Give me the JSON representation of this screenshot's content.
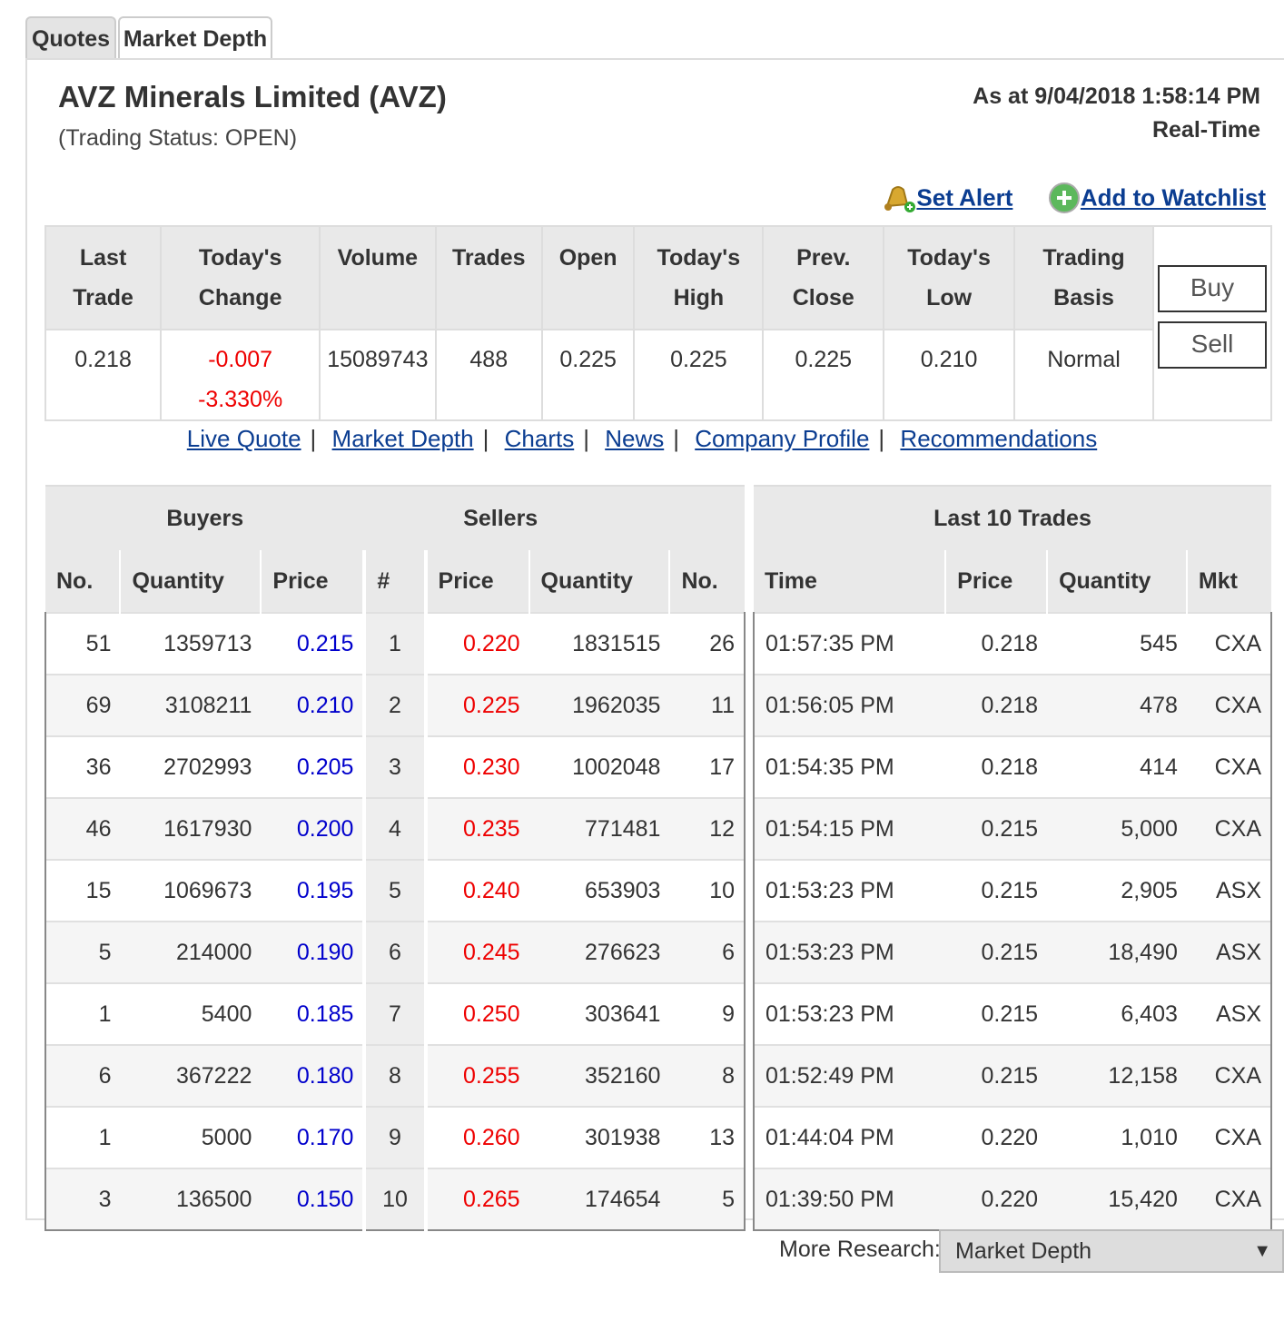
{
  "tabs": [
    {
      "label": "Quotes"
    },
    {
      "label": "Market Depth"
    }
  ],
  "company": {
    "name": "AVZ Minerals Limited (AVZ)",
    "status": "(Trading Status: OPEN)"
  },
  "as_at": {
    "datetime": "As at 9/04/2018 1:58:14 PM",
    "feed": "Real-Time"
  },
  "actions": {
    "set_alert": "Set Alert",
    "add_watchlist": "Add to Watchlist"
  },
  "quote_headers": [
    [
      "Last",
      "Trade"
    ],
    [
      "Today's",
      "Change"
    ],
    [
      "Volume",
      ""
    ],
    [
      "Trades",
      ""
    ],
    [
      "Open",
      ""
    ],
    [
      "Today's",
      "High"
    ],
    [
      "Prev.",
      "Close"
    ],
    [
      "Today's",
      "Low"
    ],
    [
      "Trading",
      "Basis"
    ]
  ],
  "quote_values": {
    "last_trade": "0.218",
    "change": "-0.007",
    "change_pct": "-3.330%",
    "volume": "15089743",
    "trades": "488",
    "open": "0.225",
    "high": "0.225",
    "prev_close": "0.225",
    "low": "0.210",
    "basis": "Normal"
  },
  "buttons": {
    "buy": "Buy",
    "sell": "Sell"
  },
  "nav_links": [
    "Live Quote",
    "Market Depth",
    "Charts",
    "News",
    "Company Profile",
    "Recommendations"
  ],
  "depth": {
    "buyers_title": "Buyers",
    "sellers_title": "Sellers",
    "buyer_cols": [
      "No.",
      "Quantity",
      "Price"
    ],
    "num_col": "#",
    "seller_cols": [
      "Price",
      "Quantity",
      "No."
    ],
    "buyers": [
      [
        "51",
        "1359713",
        "0.215"
      ],
      [
        "69",
        "3108211",
        "0.210"
      ],
      [
        "36",
        "2702993",
        "0.205"
      ],
      [
        "46",
        "1617930",
        "0.200"
      ],
      [
        "15",
        "1069673",
        "0.195"
      ],
      [
        "5",
        "214000",
        "0.190"
      ],
      [
        "1",
        "5400",
        "0.185"
      ],
      [
        "6",
        "367222",
        "0.180"
      ],
      [
        "1",
        "5000",
        "0.170"
      ],
      [
        "3",
        "136500",
        "0.150"
      ]
    ],
    "levels": [
      "1",
      "2",
      "3",
      "4",
      "5",
      "6",
      "7",
      "8",
      "9",
      "10"
    ],
    "sellers": [
      [
        "0.220",
        "1831515",
        "26"
      ],
      [
        "0.225",
        "1962035",
        "11"
      ],
      [
        "0.230",
        "1002048",
        "17"
      ],
      [
        "0.235",
        "771481",
        "12"
      ],
      [
        "0.240",
        "653903",
        "10"
      ],
      [
        "0.245",
        "276623",
        "6"
      ],
      [
        "0.250",
        "303641",
        "9"
      ],
      [
        "0.255",
        "352160",
        "8"
      ],
      [
        "0.260",
        "301938",
        "13"
      ],
      [
        "0.265",
        "174654",
        "5"
      ]
    ]
  },
  "trades": {
    "title": "Last 10 Trades",
    "cols": [
      "Time",
      "Price",
      "Quantity",
      "Mkt"
    ],
    "rows": [
      [
        "01:57:35 PM",
        "0.218",
        "545",
        "CXA"
      ],
      [
        "01:56:05 PM",
        "0.218",
        "478",
        "CXA"
      ],
      [
        "01:54:35 PM",
        "0.218",
        "414",
        "CXA"
      ],
      [
        "01:54:15 PM",
        "0.215",
        "5,000",
        "CXA"
      ],
      [
        "01:53:23 PM",
        "0.215",
        "2,905",
        "ASX"
      ],
      [
        "01:53:23 PM",
        "0.215",
        "18,490",
        "ASX"
      ],
      [
        "01:53:23 PM",
        "0.215",
        "6,403",
        "ASX"
      ],
      [
        "01:52:49 PM",
        "0.215",
        "12,158",
        "CXA"
      ],
      [
        "01:44:04 PM",
        "0.220",
        "1,010",
        "CXA"
      ],
      [
        "01:39:50 PM",
        "0.220",
        "15,420",
        "CXA"
      ]
    ]
  },
  "research": {
    "label": "More Research:",
    "selected": "Market Depth"
  },
  "colors": {
    "buy_price": "#0000cc",
    "sell_price": "#ee0000",
    "link": "#0b3d91"
  }
}
